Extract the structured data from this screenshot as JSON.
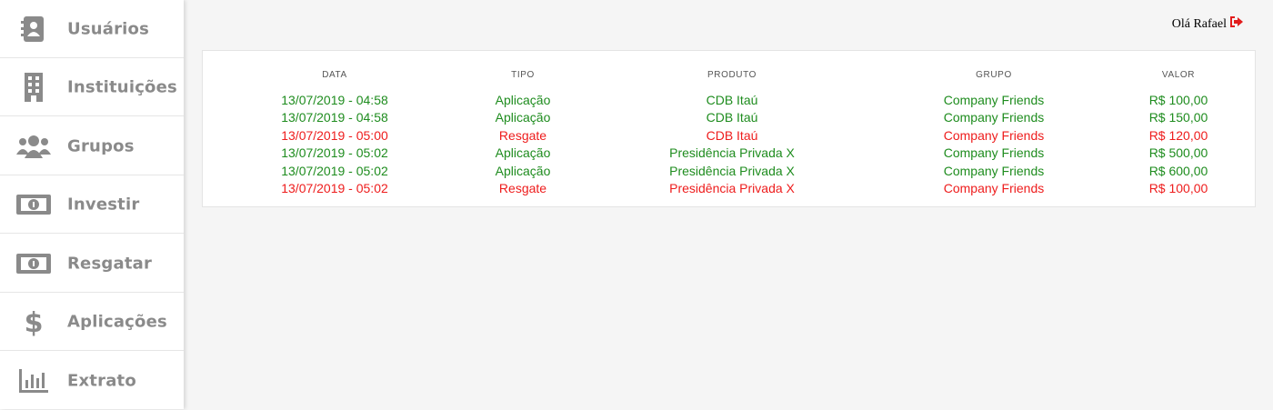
{
  "sidebar": {
    "items": [
      {
        "label": "Usuários",
        "icon": "address-book-icon"
      },
      {
        "label": "Instituições",
        "icon": "building-icon"
      },
      {
        "label": "Grupos",
        "icon": "users-icon"
      },
      {
        "label": "Investir",
        "icon": "money-bill-icon"
      },
      {
        "label": "Resgatar",
        "icon": "money-bill-icon"
      },
      {
        "label": "Aplicações",
        "icon": "dollar-icon"
      },
      {
        "label": "Extrato",
        "icon": "bar-chart-icon"
      }
    ]
  },
  "header": {
    "greeting": "Olá Rafael",
    "logout_icon": "sign-out-icon"
  },
  "table": {
    "columns": [
      "DATA",
      "TIPO",
      "PRODUTO",
      "GRUPO",
      "VALOR"
    ],
    "rows": [
      {
        "data": "13/07/2019 - 04:58",
        "tipo": "Aplicação",
        "produto": "CDB Itaú",
        "grupo": "Company Friends",
        "valor": "R$ 100,00",
        "status": "green"
      },
      {
        "data": "13/07/2019 - 04:58",
        "tipo": "Aplicação",
        "produto": "CDB Itaú",
        "grupo": "Company Friends",
        "valor": "R$ 150,00",
        "status": "green"
      },
      {
        "data": "13/07/2019 - 05:00",
        "tipo": "Resgate",
        "produto": "CDB Itaú",
        "grupo": "Company Friends",
        "valor": "R$ 120,00",
        "status": "red"
      },
      {
        "data": "13/07/2019 - 05:02",
        "tipo": "Aplicação",
        "produto": "Presidência Privada X",
        "grupo": "Company Friends",
        "valor": "R$ 500,00",
        "status": "green"
      },
      {
        "data": "13/07/2019 - 05:02",
        "tipo": "Aplicação",
        "produto": "Presidência Privada X",
        "grupo": "Company Friends",
        "valor": "R$ 600,00",
        "status": "green"
      },
      {
        "data": "13/07/2019 - 05:02",
        "tipo": "Resgate",
        "produto": "Presidência Privada X",
        "grupo": "Company Friends",
        "valor": "R$ 100,00",
        "status": "red"
      }
    ]
  },
  "colors": {
    "aplicacao": "#1e8c1e",
    "resgate": "#ee1c1c",
    "sidebar_text": "#8a8a8a",
    "background": "#f5f5f5"
  }
}
